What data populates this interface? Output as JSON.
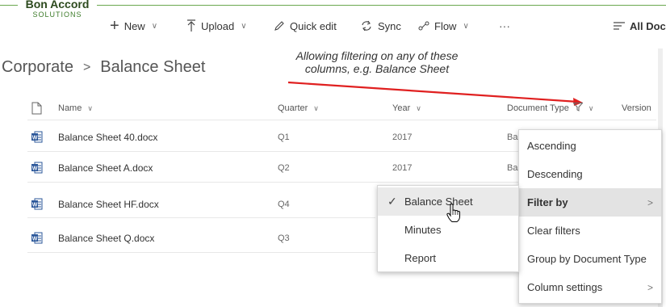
{
  "logo": {
    "main": "Bon Accord",
    "sub": "SOLUTIONS"
  },
  "commandbar": {
    "new_label": "New",
    "upload_label": "Upload",
    "quick_edit_label": "Quick edit",
    "sync_label": "Sync",
    "flow_label": "Flow",
    "more_label": "···",
    "view_label": "All Doc"
  },
  "breadcrumb": {
    "parent": "Corporate",
    "separator": ">",
    "current": "Balance Sheet"
  },
  "annotation": {
    "line1": "Allowing filtering on any of these",
    "line2": "columns, e.g. Balance Sheet"
  },
  "columns": {
    "name": "Name",
    "quarter": "Quarter",
    "year": "Year",
    "document_type": "Document Type",
    "version": "Version"
  },
  "rows": [
    {
      "name": "Balance Sheet 40.docx",
      "quarter": "Q1",
      "year": "2017",
      "doc_type": "Bal"
    },
    {
      "name": "Balance Sheet A.docx",
      "quarter": "Q2",
      "year": "2017",
      "doc_type": "Bal"
    },
    {
      "name": "Balance Sheet HF.docx",
      "quarter": "Q4",
      "year": "",
      "doc_type": ""
    },
    {
      "name": "Balance Sheet Q.docx",
      "quarter": "Q3",
      "year": "",
      "doc_type": ""
    }
  ],
  "column_menu": {
    "items": [
      "Ascending",
      "Descending",
      "Filter by",
      "Clear filters",
      "Group by Document Type",
      "Column settings"
    ],
    "submenu_chevron": ">"
  },
  "filter_submenu": {
    "check_mark": "✓",
    "options": [
      "Balance Sheet",
      "Minutes",
      "Report"
    ],
    "checked_index": 0
  },
  "colors": {
    "accent_green": "#3d7c2a",
    "arrow_red": "#e02020",
    "word_blue": "#2b579a"
  }
}
